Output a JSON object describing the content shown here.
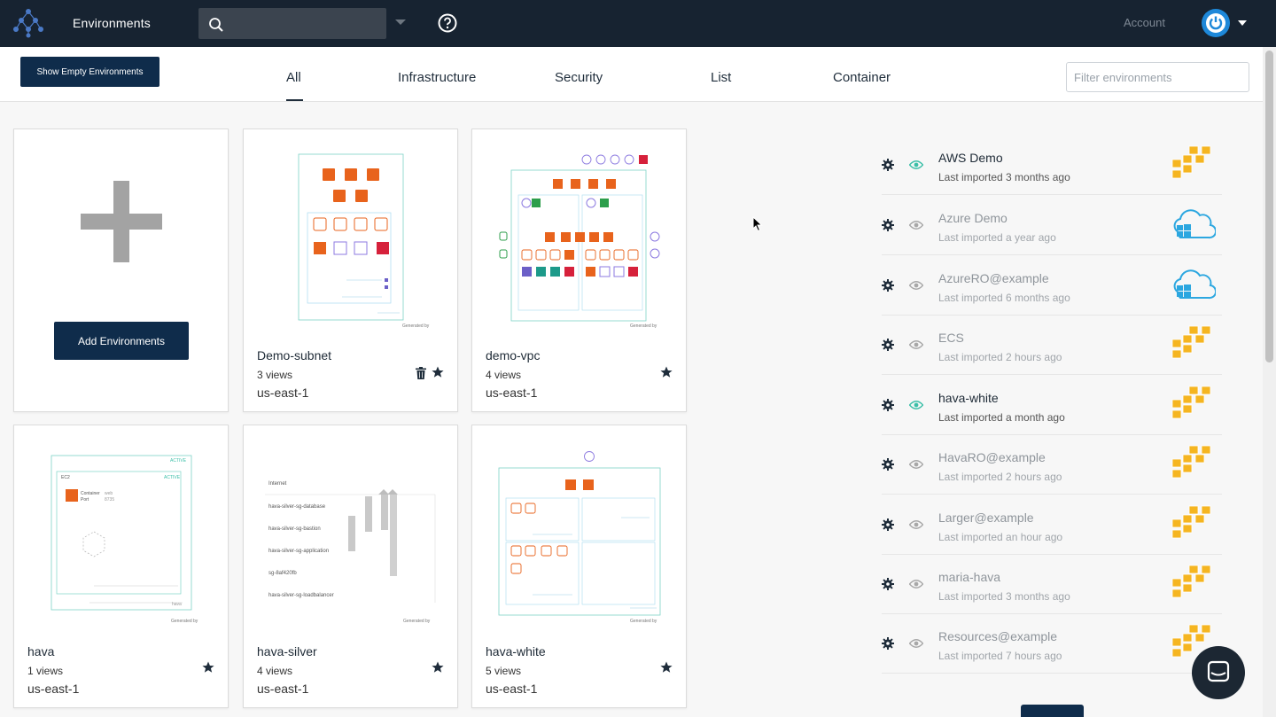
{
  "header": {
    "title": "Environments",
    "search": {
      "value": "",
      "placeholder": ""
    },
    "account_label": "Account",
    "colors": {
      "bar": "#172331",
      "avatar": "#1e88d9"
    }
  },
  "toolbar": {
    "show_empty_label": "Show Empty Environments",
    "tabs": [
      {
        "label": "All",
        "active": true
      },
      {
        "label": "Infrastructure",
        "active": false
      },
      {
        "label": "Security",
        "active": false
      },
      {
        "label": "List",
        "active": false
      },
      {
        "label": "Container",
        "active": false
      }
    ],
    "filter": {
      "value": "",
      "placeholder": "Filter environments"
    }
  },
  "add_card": {
    "button_label": "Add Environments"
  },
  "cards": [
    {
      "name": "Demo-subnet",
      "views": "3 views",
      "region": "us-east-1",
      "generated_by": "Generated by",
      "has_trash": true
    },
    {
      "name": "demo-vpc",
      "views": "4 views",
      "region": "us-east-1",
      "generated_by": "Generated by",
      "has_trash": false
    },
    {
      "name": "hava",
      "views": "1 views",
      "region": "us-east-1",
      "generated_by": "Generated by",
      "has_trash": false
    },
    {
      "name": "hava-silver",
      "views": "4 views",
      "region": "us-east-1",
      "generated_by": "Generated by",
      "has_trash": false
    },
    {
      "name": "hava-white",
      "views": "5 views",
      "region": "us-east-1",
      "generated_by": "Generated by",
      "has_trash": false
    }
  ],
  "thumbnails": {
    "hava": {
      "tag": "ACTIVE",
      "box_title": "EC2",
      "box_tag": "ACTIVE",
      "container_label": "Container",
      "port_label": "Port",
      "container_value": "web",
      "port_value": "8735",
      "footer": "hava"
    },
    "hava_silver": {
      "internet_label": "Internet",
      "groups": [
        "hava-silver-sg-database",
        "hava-silver-sg-bastion",
        "hava-silver-sg-application",
        "sg-8af420fb",
        "hava-silver-sg-loadbalancer"
      ]
    }
  },
  "recent": [
    {
      "name": "AWS Demo",
      "imported": "Last imported 3 months ago",
      "provider": "aws",
      "visible": true
    },
    {
      "name": "Azure Demo",
      "imported": "Last imported a year ago",
      "provider": "azure",
      "visible": false
    },
    {
      "name": "AzureRO@example",
      "imported": "Last imported 6 months ago",
      "provider": "azure",
      "visible": false
    },
    {
      "name": "ECS",
      "imported": "Last imported 2 hours ago",
      "provider": "aws",
      "visible": false
    },
    {
      "name": "hava-white",
      "imported": "Last imported a month ago",
      "provider": "aws",
      "visible": true
    },
    {
      "name": "HavaRO@example",
      "imported": "Last imported 2 hours ago",
      "provider": "aws",
      "visible": false
    },
    {
      "name": "Larger@example",
      "imported": "Last imported an hour ago",
      "provider": "aws",
      "visible": false
    },
    {
      "name": "maria-hava",
      "imported": "Last imported 3 months ago",
      "provider": "aws",
      "visible": false
    },
    {
      "name": "Resources@example",
      "imported": "Last imported 7 hours ago",
      "provider": "aws",
      "visible": false
    }
  ],
  "colors": {
    "primary": "#0f2c4b",
    "eye_active": "#3bbfa8",
    "eye_inactive": "#a8a8a8",
    "aws": "#f5b520",
    "azure": "#2ca7e0",
    "orange": "#e8631c"
  }
}
